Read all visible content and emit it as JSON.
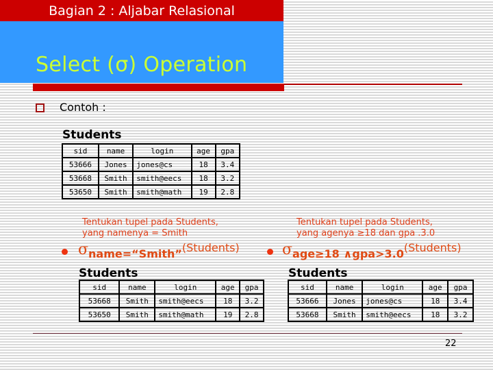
{
  "header": {
    "section_title": "Bagian 2 : Aljabar Relasional"
  },
  "slide": {
    "title": "Select (σ) Operation",
    "bullet_label": "Contoh :",
    "page_number": "22"
  },
  "colors": {
    "header_red": "#cc0000",
    "title_blue": "#3399ff",
    "title_text": "#ccff33",
    "accent_orange": "#e04a14"
  },
  "source_table": {
    "caption": "Students",
    "columns": [
      "sid",
      "name",
      "login",
      "age",
      "gpa"
    ],
    "rows": [
      [
        "53666",
        "Jones",
        "jones@cs",
        "18",
        "3.4"
      ],
      [
        "53668",
        "Smith",
        "smith@eecs",
        "18",
        "3.2"
      ],
      [
        "53650",
        "Smith",
        "smith@math",
        "19",
        "2.8"
      ]
    ]
  },
  "example_left": {
    "task_line1": "Tentukan tupel pada Students,",
    "task_line2": "yang namenya = Smith",
    "sigma": "σ",
    "condition": "name=“Smith”",
    "argument": "(Students)",
    "result_caption": "Students",
    "columns": [
      "sid",
      "name",
      "login",
      "age",
      "gpa"
    ],
    "rows": [
      [
        "53668",
        "Smith",
        "smith@eecs",
        "18",
        "3.2"
      ],
      [
        "53650",
        "Smith",
        "smith@math",
        "19",
        "2.8"
      ]
    ]
  },
  "example_right": {
    "task_line1": "Tentukan tupel pada Students,",
    "task_line2": "yang agenya ≥18 dan gpa .3.0",
    "sigma": "σ",
    "condition": "age≥18 ∧gpa>3.0",
    "argument": "(Students)",
    "result_caption": "Students",
    "columns": [
      "sid",
      "name",
      "login",
      "age",
      "gpa"
    ],
    "rows": [
      [
        "53666",
        "Jones",
        "jones@cs",
        "18",
        "3.4"
      ],
      [
        "53668",
        "Smith",
        "smith@eecs",
        "18",
        "3.2"
      ]
    ]
  }
}
